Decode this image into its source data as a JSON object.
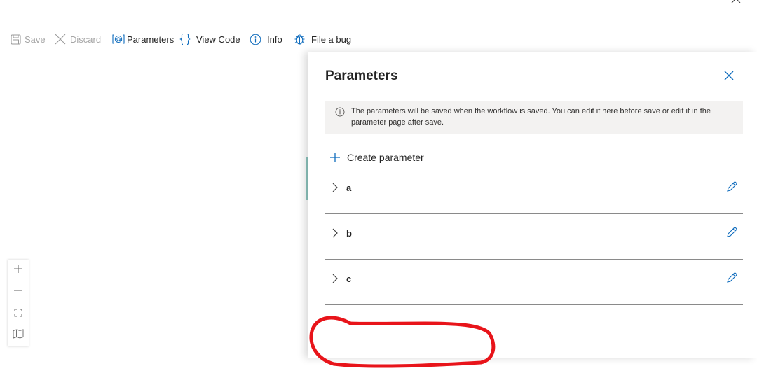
{
  "toolbar": {
    "save_label": "Save",
    "discard_label": "Discard",
    "parameters_label": "Parameters",
    "view_code_label": "View Code",
    "info_label": "Info",
    "file_bug_label": "File a bug"
  },
  "panel": {
    "title": "Parameters",
    "info_text": "The parameters will be saved when the workflow is saved. You can edit it here before save or edit it in the parameter page after save.",
    "create_label": "Create parameter",
    "parameters": [
      {
        "name": "a"
      },
      {
        "name": "b"
      },
      {
        "name": "c"
      }
    ]
  },
  "icons": {
    "save": "save-icon",
    "discard": "close-icon",
    "parameters": "at-bracket-icon",
    "view_code": "braces-icon",
    "info": "info-icon",
    "bug": "bug-icon",
    "chevron": "chevron-right-icon",
    "edit": "pencil-icon",
    "zoom_in": "plus-icon",
    "zoom_out": "minus-icon",
    "fit": "fit-view-icon",
    "minimap": "map-icon"
  },
  "colors": {
    "accent": "#0f6cbd",
    "annotation": "#e8141a",
    "disabled": "#a6a6a6"
  }
}
